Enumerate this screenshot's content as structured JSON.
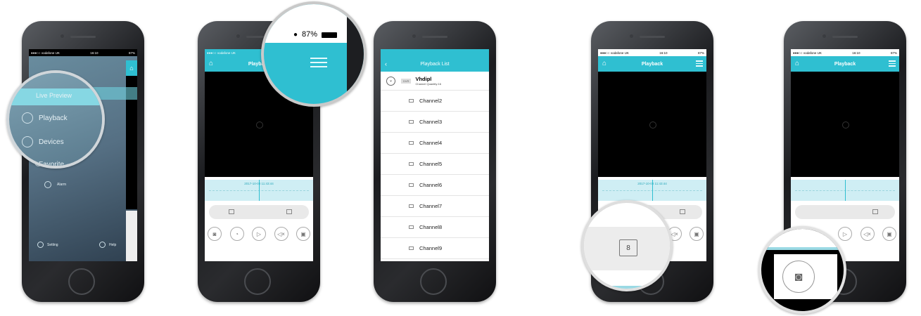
{
  "phone1": {
    "carrier": "●●●○○ vodafone UK",
    "time": "16:10",
    "battery": "87%",
    "menu": [
      {
        "label": "Live Preview",
        "icon": "live-preview-icon"
      },
      {
        "label": "Playback",
        "icon": "playback-icon"
      },
      {
        "label": "Devices",
        "icon": "devices-icon"
      },
      {
        "label": "Favorite",
        "icon": "favorite-icon"
      },
      {
        "label": "Alarm",
        "icon": "alarm-icon"
      }
    ],
    "setting_label": "Setting",
    "help_label": "Help"
  },
  "phone2": {
    "carrier": "●●●○○ vodafone UK",
    "title": "Playback",
    "zoom_battery": "87%",
    "timeline_stamp": "2017-10-03 11:43:44"
  },
  "phone3": {
    "title": "Playback List",
    "device_name": "Vhdipl",
    "device_badge": "DVR",
    "device_sub": "Channel Quantity:16",
    "channels": [
      "Channel2",
      "Channel3",
      "Channel4",
      "Channel5",
      "Channel6",
      "Channel7",
      "Channel8",
      "Channel9"
    ]
  },
  "phone4": {
    "carrier": "●●●○○ vodafone UK",
    "time": "16:10",
    "battery": "87%",
    "title": "Playback",
    "timeline_stamp": "2017-10-03 11:43:44",
    "calendar_day": "8"
  },
  "phone5": {
    "carrier": "●●●○○ vodafone UK",
    "time": "16:10",
    "battery": "87%",
    "title": "Playback"
  },
  "colors": {
    "accent": "#2fbfd1",
    "video": "#000000",
    "device": "#1e1f22"
  }
}
